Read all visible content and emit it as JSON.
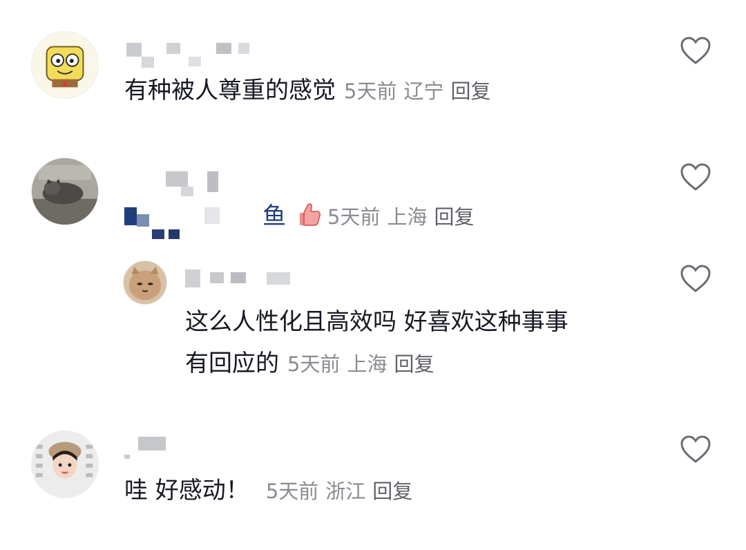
{
  "comments": [
    {
      "name": "",
      "text": "有种被人尊重的感觉",
      "time": "5天前",
      "location": "辽宁",
      "reply_label": "回复",
      "avatar_icon": "sponge-cartoon-avatar"
    },
    {
      "name": "",
      "text_tail": "鱼",
      "emoji_icon": "thumbs-up-emoji-icon",
      "time": "5天前",
      "location": "上海",
      "reply_label": "回复",
      "avatar_icon": "cat-photo-avatar"
    },
    {
      "name": "",
      "text_line1": "这么人性化且高效吗 好喜欢这种事事",
      "text_line2": "有回应的",
      "time": "5天前",
      "location": "上海",
      "reply_label": "回复",
      "avatar_icon": "cat-face-avatar",
      "is_reply": true
    },
    {
      "name": "",
      "text": "哇 好感动！",
      "time": "5天前",
      "location": "浙江",
      "reply_label": "回复",
      "avatar_icon": "girl-photo-avatar"
    }
  ],
  "colors": {
    "text": "#161823",
    "meta": "#8a8b91",
    "heart_outline": "#6b6c72",
    "mention": "#1f3f7a"
  }
}
